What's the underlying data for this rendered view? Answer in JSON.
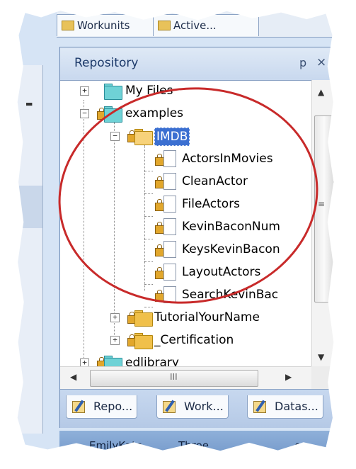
{
  "top_tabs": [
    {
      "label": "Workunits"
    },
    {
      "label": "Active..."
    }
  ],
  "panel": {
    "title": "Repository",
    "pin_glyph": "p",
    "close_glyph": "×"
  },
  "tree": [
    {
      "label": "My Files",
      "expander": "+",
      "icon": "folder-teal-icon"
    },
    {
      "label": "examples",
      "expander": "−",
      "icon": "folder-teal-locked-icon"
    },
    {
      "label": "IMDB",
      "expander": "−",
      "icon": "folder-open-locked-icon",
      "selected": true
    },
    {
      "label": "ActorsInMovies",
      "icon": "locked-file-icon"
    },
    {
      "label": "CleanActor",
      "icon": "locked-file-icon"
    },
    {
      "label": "FileActors",
      "icon": "locked-file-icon"
    },
    {
      "label": "KevinBaconNum",
      "icon": "locked-file-icon"
    },
    {
      "label": "KeysKevinBacon",
      "icon": "locked-file-icon"
    },
    {
      "label": "LayoutActors",
      "icon": "locked-file-icon"
    },
    {
      "label": "SearchKevinBac",
      "icon": "locked-file-icon"
    },
    {
      "label": "TutorialYourName",
      "expander": "+",
      "icon": "folder-locked-icon"
    },
    {
      "label": "_Certification",
      "expander": "+",
      "icon": "folder-locked-icon"
    },
    {
      "label": "edlibrary",
      "expander": "+",
      "icon": "folder-teal-locked-icon"
    }
  ],
  "scrollbars": {
    "vertical_grip": "≡",
    "horizontal_grip": "III"
  },
  "bottom_tabs": [
    {
      "label": "Repo..."
    },
    {
      "label": "Work..."
    },
    {
      "label": "Datas..."
    }
  ],
  "status_bar": {
    "left": "EmilyKate",
    "middle": "Three",
    "right": "...or"
  },
  "colors": {
    "selection": "#3b6fd1",
    "highlight_ring": "#c82a2a"
  }
}
